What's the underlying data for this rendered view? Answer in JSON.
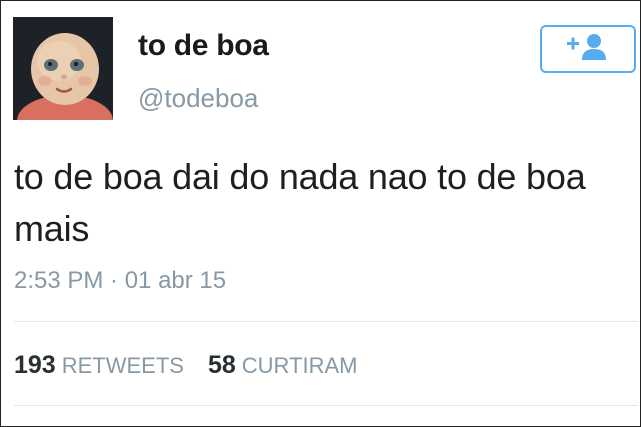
{
  "tweet": {
    "display_name": "to de boa",
    "handle": "@todeboa",
    "text": "to de boa dai do nada nao to de boa mais",
    "timestamp": "2:53 PM · 01 abr 15",
    "follow_button_icon": "add-user-icon",
    "accent_color": "#55acee"
  },
  "stats": {
    "retweets_count": "193",
    "retweets_label": "RETWEETS",
    "likes_count": "58",
    "likes_label": "CURTIRAM"
  }
}
